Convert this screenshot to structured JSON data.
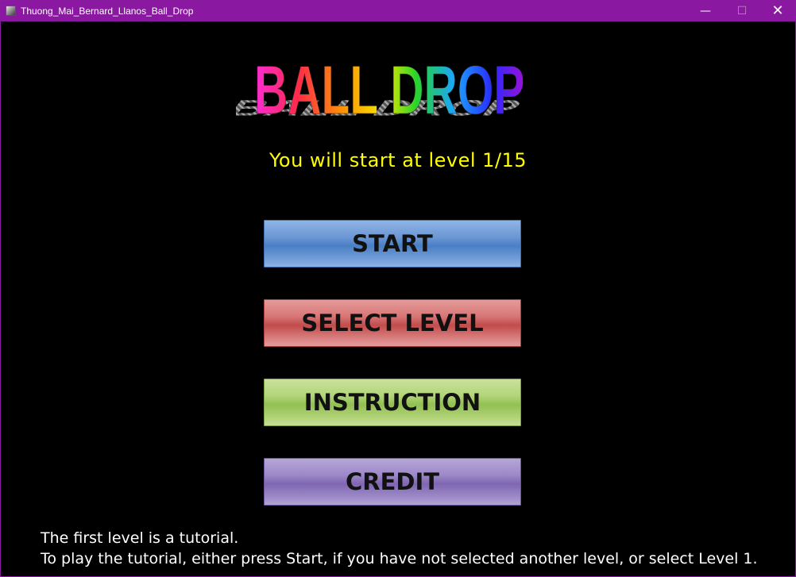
{
  "window": {
    "title": "Thuong_Mai_Bernard_Llanos_Ball_Drop",
    "minimize_glyph": "—",
    "maximize_glyph": "☐",
    "close_glyph": "✕"
  },
  "logo": {
    "text": "BALL DROP",
    "gradient_colors": [
      "#ff2bd6",
      "#ff2a4a",
      "#ff9a00",
      "#f2e600",
      "#28d42a",
      "#1aa6ff",
      "#2a2aff",
      "#9b10d8"
    ],
    "shadow_color": "#9a9a9a"
  },
  "status": {
    "text": "You will start at level 1/15",
    "color": "#ffff00"
  },
  "menu": {
    "start": "START",
    "select_level": "SELECT LEVEL",
    "instruction": "INSTRUCTION",
    "credit": "CREDIT"
  },
  "footer": {
    "line1": "The first level is a tutorial.",
    "line2": "To play the tutorial, either press Start, if you have not selected another level, or select Level 1."
  }
}
